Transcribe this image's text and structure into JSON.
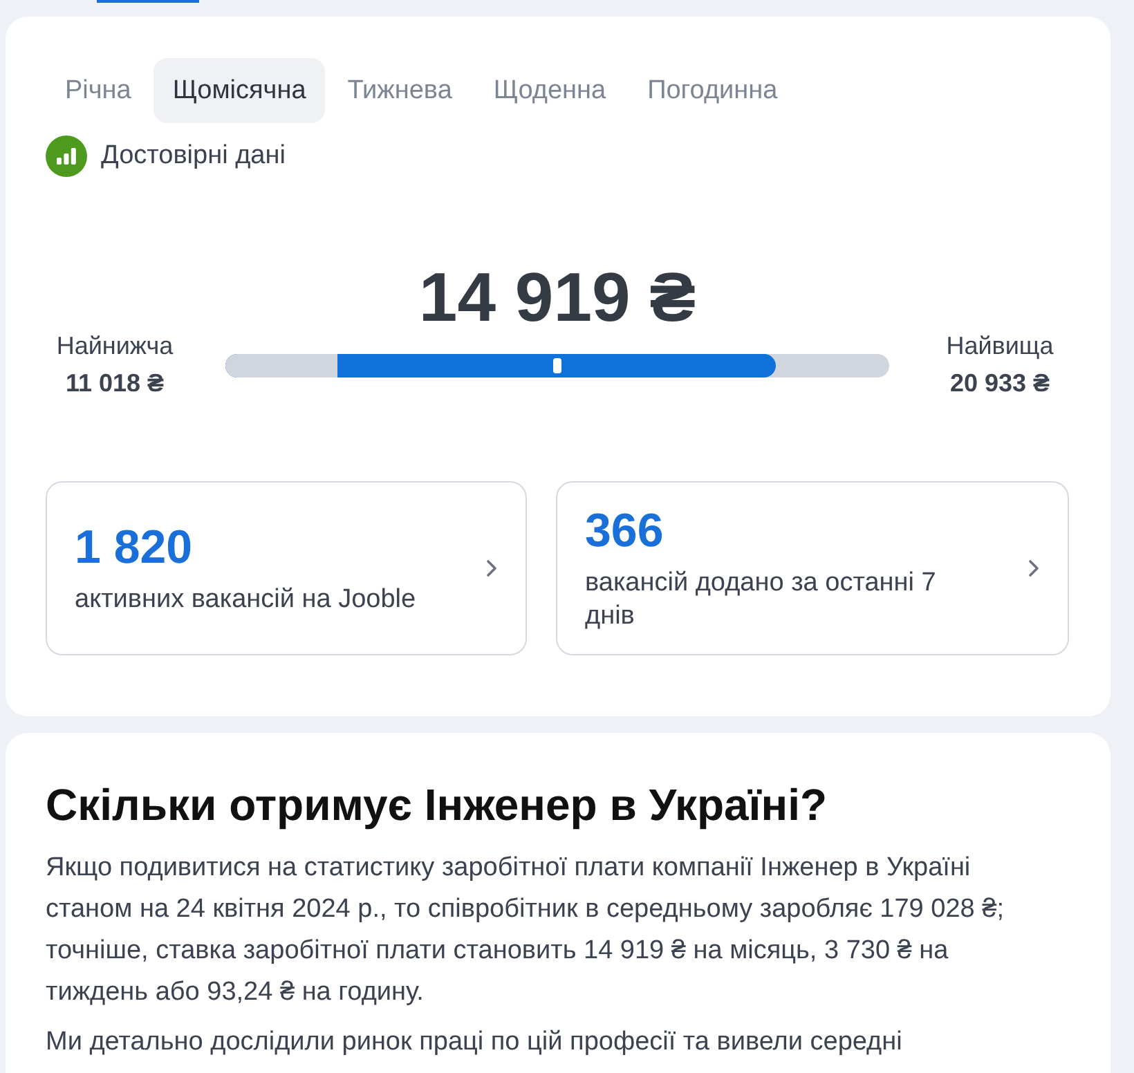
{
  "tabs": [
    {
      "label": "Річна",
      "selected": false
    },
    {
      "label": "Щомісячна",
      "selected": true
    },
    {
      "label": "Тижнева",
      "selected": false
    },
    {
      "label": "Щоденна",
      "selected": false
    },
    {
      "label": "Погодинна",
      "selected": false
    }
  ],
  "reliability": {
    "label": "Достовірні дані"
  },
  "salary": {
    "value": "14 919 ₴",
    "low": {
      "label": "Найнижча",
      "value": "11 018 ₴"
    },
    "high": {
      "label": "Найвища",
      "value": "20 933 ₴"
    },
    "range_bar": {
      "high": {
        "level": 0.829
      },
      "low": {
        "level": 0.169
      },
      "marker": {
        "level": 0.5
      }
    }
  },
  "stats": [
    {
      "value": "1 820",
      "label": "активних вакансій на Jooble"
    },
    {
      "value": "366",
      "label": "вакансій додано за останні 7 днів"
    }
  ],
  "article": {
    "heading": "Скільки отримує Інженер в Україні?",
    "paragraphs": [
      "Якщо подивитися на статистику заробітної плати компанії Інженер в Україні станом на 24 квітня 2024 р., то співробітник в середньому заробляє 179 028 ₴; точніше, ставка заробітної плати становить 14 919 ₴ на місяць, 3 730 ₴ на тиждень або 93,24 ₴ на годину.",
      "Ми детально дослідили ринок праці по цій професії та вивели середні"
    ]
  }
}
